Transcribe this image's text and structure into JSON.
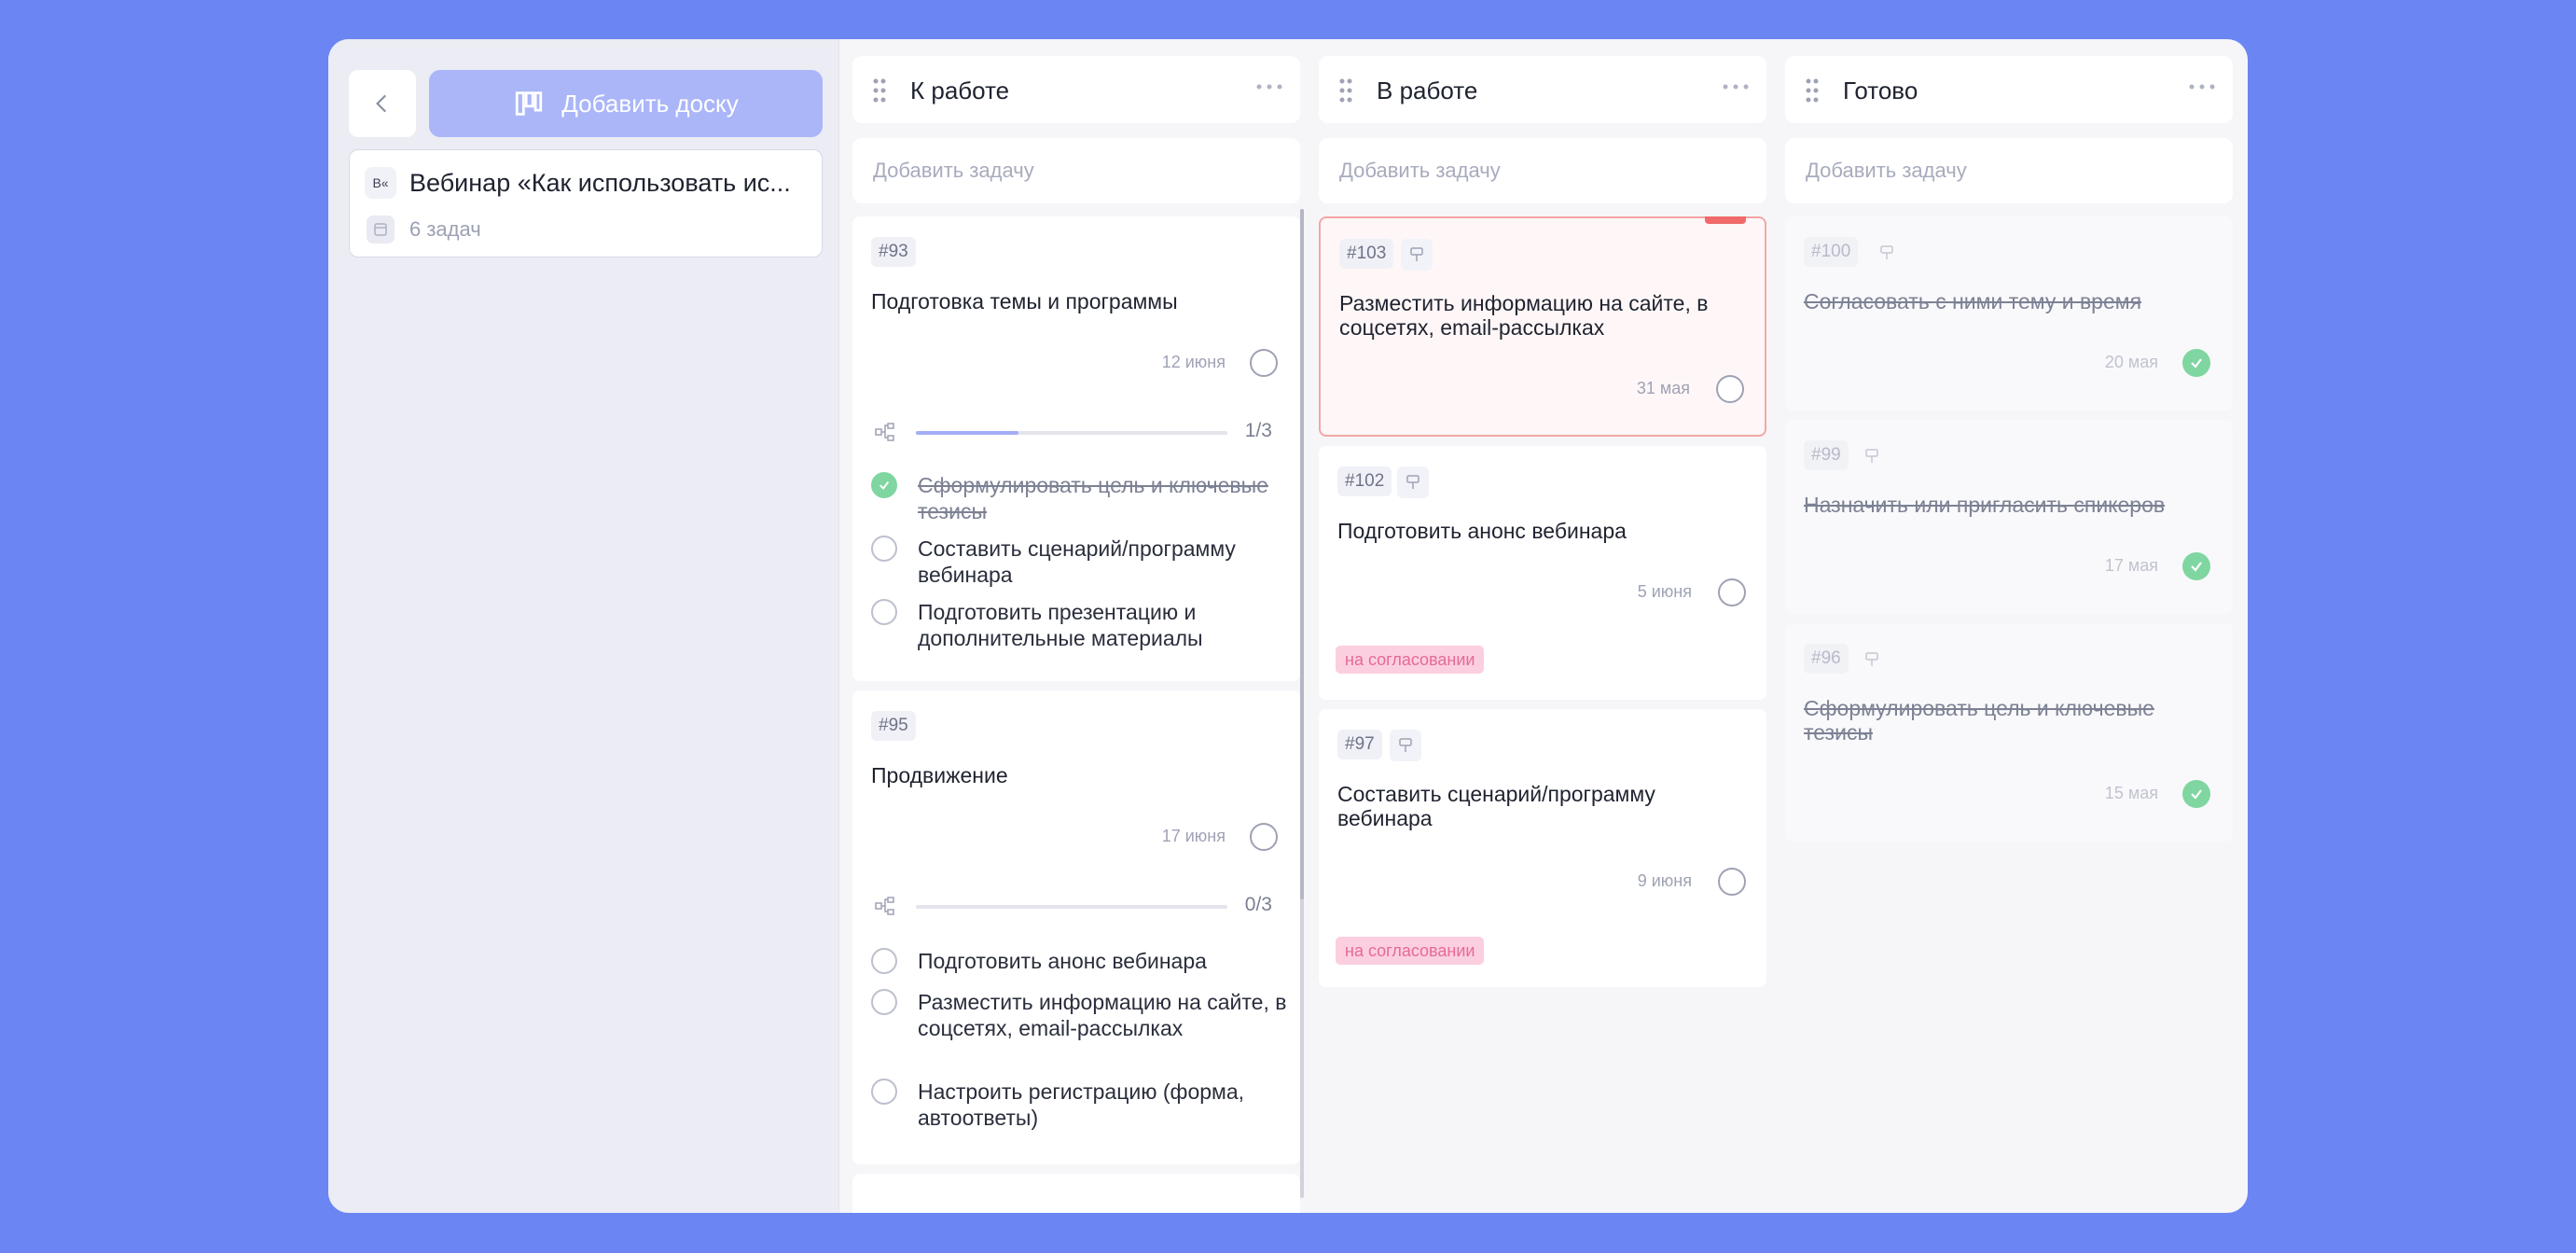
{
  "sidebar": {
    "add_board_label": "Добавить доску",
    "board": {
      "badge": "В«",
      "title": "Вебинар «Как использовать ис...",
      "count": "6 задач"
    }
  },
  "columns": [
    {
      "title": "К работе",
      "add_task_placeholder": "Добавить задачу",
      "cards": [
        {
          "num": "#93",
          "title": "Подготовка темы и программы",
          "due": "12 июня",
          "progress_text": "1/3",
          "progress": 0.33,
          "subtasks": [
            {
              "label": "Сформулировать цель и ключевые тезисы",
              "done": true
            },
            {
              "label": "Составить сценарий/программу вебинара",
              "done": false
            },
            {
              "label": "Подготовить презентацию и дополнительные материалы",
              "done": false
            }
          ]
        },
        {
          "num": "#95",
          "title": "Продвижение",
          "due": "17 июня",
          "progress_text": "0/3",
          "progress": 0,
          "subtasks": [
            {
              "label": "Подготовить анонс вебинара",
              "done": false
            },
            {
              "label": "Разместить информацию на сайте, в соцсетях, email-рассылках",
              "done": false
            },
            {
              "label": "Настроить регистрацию (форма, автоответы)",
              "done": false
            }
          ]
        }
      ]
    },
    {
      "title": "В работе",
      "add_task_placeholder": "Добавить задачу",
      "cards": [
        {
          "num": "#103",
          "title": "Разместить информацию на сайте, в соцсетях, email-рассылках",
          "due": "31 мая"
        },
        {
          "num": "#102",
          "title": "Подготовить анонс вебинара",
          "due": "5 июня",
          "tag": "на согласовании"
        },
        {
          "num": "#97",
          "title": "Составить сценарий/программу вебинара",
          "due": "9 июня",
          "tag": "на согласовании"
        }
      ]
    },
    {
      "title": "Готово",
      "add_task_placeholder": "Добавить задачу",
      "cards": [
        {
          "num": "#100",
          "title": "Согласовать с ними тему и время",
          "due": "20 мая"
        },
        {
          "num": "#99",
          "title": "Назначить или пригласить спикеров",
          "due": "17 мая"
        },
        {
          "num": "#96",
          "title": "Сформулировать цель и ключевые тезисы",
          "due": "15 мая"
        }
      ]
    }
  ],
  "colors": {
    "background": "#6b86f2",
    "accent": "#aab6f8",
    "done_green": "#7fd6a0",
    "tag_pink": "#fccfe0",
    "alert_red": "#f06a6a"
  }
}
